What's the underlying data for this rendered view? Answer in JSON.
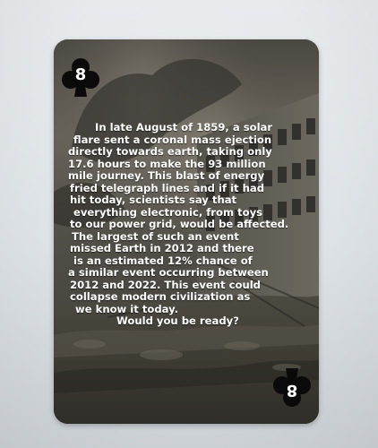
{
  "card": {
    "rank": "8",
    "suit_icon": "club-icon",
    "text_lines": [
      "In late August of 1859, a solar",
      "flare sent a coronal mass ejection",
      "directly towards earth, taking only",
      "17.6 hours to make the 93 million",
      "mile journey. This blast of energy",
      "fried telegraph lines and if it had",
      "hit today, scientists say that",
      "everything electronic, from toys",
      "to our power grid, would be affected.",
      "The largest of such an event",
      "missed Earth in 2012 and there",
      "is an estimated 12% chance of",
      "a similar event occurring between",
      "2012 and 2022. This event could",
      "collapse modern civilization as",
      "we know it today.",
      "Would you be ready?"
    ]
  },
  "colors": {
    "text": "#ffffff",
    "card_base": "#3b3a36",
    "background": "#e3e7ea"
  }
}
